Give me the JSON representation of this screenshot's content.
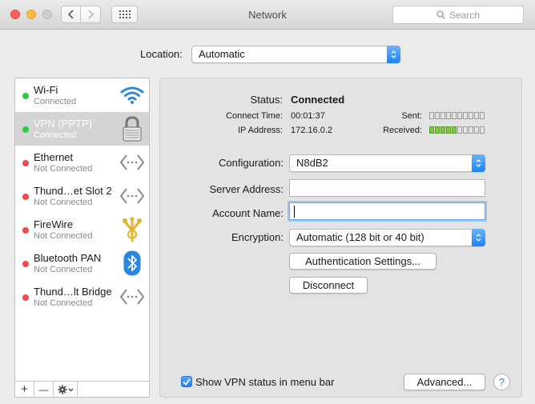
{
  "window": {
    "title": "Network"
  },
  "toolbar": {
    "search_placeholder": "Search"
  },
  "location": {
    "label": "Location:",
    "value": "Automatic"
  },
  "services": [
    {
      "name": "Wi-Fi",
      "status": "Connected",
      "dot": "green",
      "icon": "wifi-icon"
    },
    {
      "name": "VPN (PPTP)",
      "status": "Connected",
      "dot": "green",
      "icon": "lock-icon",
      "selected": true
    },
    {
      "name": "Ethernet",
      "status": "Not Connected",
      "dot": "red",
      "icon": "ethernet-arrows-icon"
    },
    {
      "name": "Thund…et Slot 2",
      "status": "Not Connected",
      "dot": "red",
      "icon": "ethernet-arrows-icon"
    },
    {
      "name": "FireWire",
      "status": "Not Connected",
      "dot": "red",
      "icon": "firewire-icon"
    },
    {
      "name": "Bluetooth PAN",
      "status": "Not Connected",
      "dot": "red",
      "icon": "bluetooth-icon"
    },
    {
      "name": "Thund…lt Bridge",
      "status": "Not Connected",
      "dot": "red",
      "icon": "ethernet-arrows-icon"
    }
  ],
  "sidebar_footer": {
    "add": "+",
    "remove": "—"
  },
  "detail": {
    "status_label": "Status:",
    "status_value": "Connected",
    "connect_time_label": "Connect Time:",
    "connect_time_value": "00:01:37",
    "ip_label": "IP Address:",
    "ip_value": "172.16.0.2",
    "sent_label": "Sent:",
    "received_label": "Received:",
    "sent_level": 0,
    "received_level": 0.5,
    "configuration_label": "Configuration:",
    "configuration_value": "N8dB2",
    "server_label": "Server Address:",
    "server_value": "",
    "account_label": "Account Name:",
    "account_value": "",
    "encryption_label": "Encryption:",
    "encryption_value": "Automatic (128 bit or 40 bit)",
    "auth_button": "Authentication Settings...",
    "disconnect_button": "Disconnect",
    "show_status_label": "Show VPN status in menu bar",
    "show_status_checked": true,
    "advanced_button": "Advanced...",
    "help_button": "?"
  },
  "colors": {
    "accent": "#1a82fb",
    "connected": "#2fc944",
    "disconnected": "#f0474c",
    "meter_on": "#7fc943"
  }
}
